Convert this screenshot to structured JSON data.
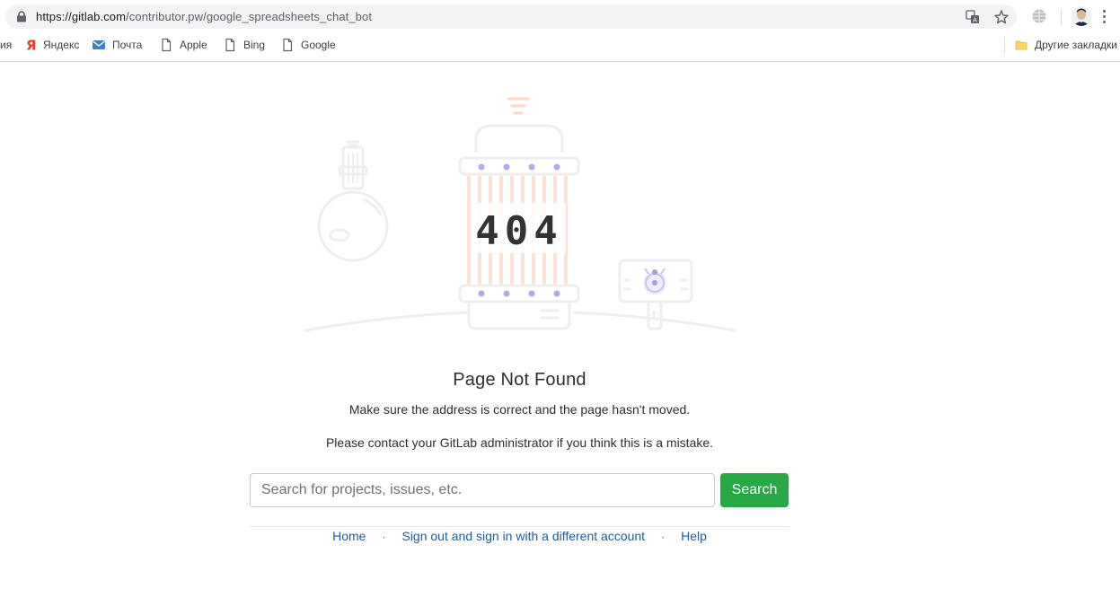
{
  "browser": {
    "url_host": "https://gitlab.com",
    "url_path": "/contributor.pw/google_spreadsheets_chat_bot",
    "icons": [
      "lock-icon",
      "translate-icon",
      "star-icon",
      "globe-extension-icon",
      "avatar",
      "menu-icon"
    ],
    "bookmarks": [
      {
        "label": "ия",
        "icon": ""
      },
      {
        "label": "Яндекс",
        "icon": "yandex-icon"
      },
      {
        "label": "Почта",
        "icon": "mail-icon"
      },
      {
        "label": "Apple",
        "icon": "page-icon"
      },
      {
        "label": "Bing",
        "icon": "page-icon"
      },
      {
        "label": "Google",
        "icon": "page-icon"
      }
    ],
    "other_bookmarks": "Другие закладки"
  },
  "page": {
    "illustration_text": "404",
    "title": "Page Not Found",
    "message_1": "Make sure the address is correct and the page hasn't moved.",
    "message_2": "Please contact your GitLab administrator if you think this is a mistake.",
    "search": {
      "placeholder": "Search for projects, issues, etc.",
      "value": "",
      "button_label": "Search"
    },
    "links": [
      {
        "label": "Home"
      },
      {
        "label": "Sign out and sign in with a different account"
      },
      {
        "label": "Help"
      }
    ],
    "link_separator": "·"
  },
  "colors": {
    "accent_green": "#28a745",
    "link_blue": "#1f5c99",
    "illustration_grey": "#eeeeee",
    "illustration_orange": "#fcd9c7",
    "illustration_purple": "#a79ce0"
  }
}
